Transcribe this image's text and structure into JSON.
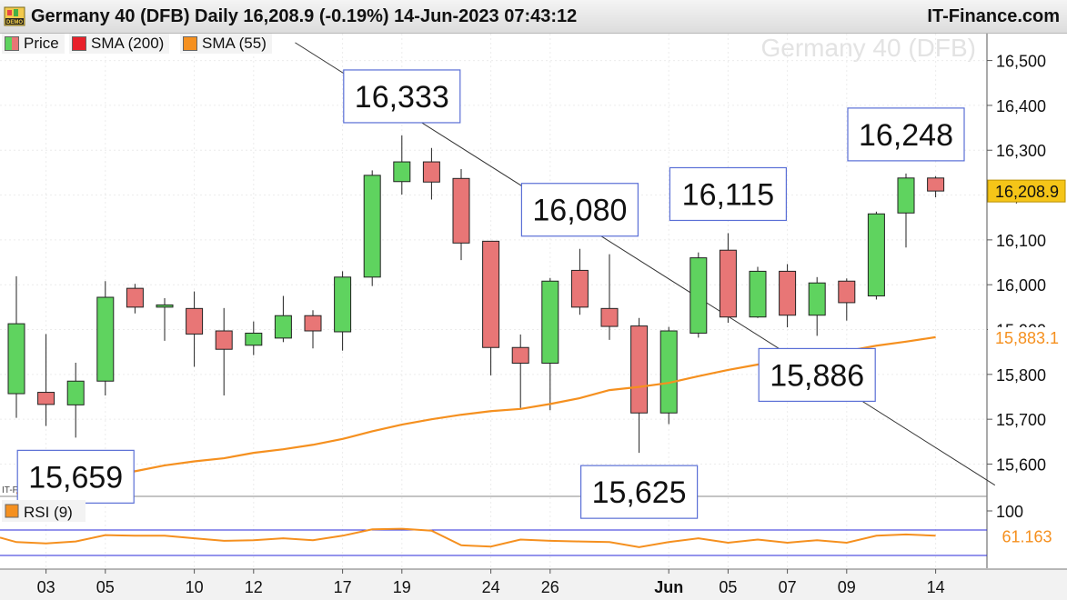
{
  "header": {
    "title": "Germany 40 (DFB) Daily 16,208.9 (-0.19%) 14-Jun-2023 07:43:12",
    "brand": "IT-Finance.com",
    "badge": "DEMO"
  },
  "legend": [
    {
      "label": "Price",
      "color": "#4caf50"
    },
    {
      "label": "SMA (200)",
      "color": "#e8202a"
    },
    {
      "label": "SMA (55)",
      "color": "#f5901f"
    }
  ],
  "watermark": "Germany 40 (DFB)",
  "small_watermark": "IT-Finance.com",
  "colors": {
    "up": "#5fd35f",
    "down": "#e87676",
    "sma55": "#f5901f",
    "trend": "#333333",
    "rsi": "#f5901f",
    "rsi_band": "#2a2ad8"
  },
  "chart_data": {
    "type": "candlestick",
    "title": "Germany 40 (DFB) Daily",
    "yticks": [
      15600,
      15700,
      15800,
      15900,
      16000,
      16100,
      16200,
      16300,
      16400,
      16500
    ],
    "ytick_labels": [
      "15,600",
      "15,700",
      "15,800",
      "15,900",
      "16,000",
      "16,100",
      "16,200",
      "16,300",
      "16,400",
      "16,500"
    ],
    "ylim": [
      15530,
      16560
    ],
    "candles": [
      {
        "o": 15757,
        "h": 16019,
        "l": 15703,
        "c": 15913
      },
      {
        "o": 15760,
        "h": 15890,
        "l": 15685,
        "c": 15733
      },
      {
        "o": 15732,
        "h": 15826,
        "l": 15659,
        "c": 15785
      },
      {
        "o": 15785,
        "h": 16008,
        "l": 15753,
        "c": 15972
      },
      {
        "o": 15992,
        "h": 16002,
        "l": 15936,
        "c": 15950
      },
      {
        "o": 15950,
        "h": 15970,
        "l": 15875,
        "c": 15955
      },
      {
        "o": 15947,
        "h": 15985,
        "l": 15817,
        "c": 15890
      },
      {
        "o": 15897,
        "h": 15948,
        "l": 15753,
        "c": 15856
      },
      {
        "o": 15865,
        "h": 15918,
        "l": 15843,
        "c": 15892
      },
      {
        "o": 15881,
        "h": 15975,
        "l": 15872,
        "c": 15931
      },
      {
        "o": 15931,
        "h": 15943,
        "l": 15858,
        "c": 15897
      },
      {
        "o": 15895,
        "h": 16030,
        "l": 15853,
        "c": 16017
      },
      {
        "o": 16017,
        "h": 16255,
        "l": 15997,
        "c": 16244
      },
      {
        "o": 16230,
        "h": 16333,
        "l": 16201,
        "c": 16274
      },
      {
        "o": 16274,
        "h": 16305,
        "l": 16190,
        "c": 16229
      },
      {
        "o": 16237,
        "h": 16258,
        "l": 16055,
        "c": 16093
      },
      {
        "o": 16097,
        "h": 16097,
        "l": 15798,
        "c": 15860
      },
      {
        "o": 15860,
        "h": 15889,
        "l": 15725,
        "c": 15825
      },
      {
        "o": 15825,
        "h": 16015,
        "l": 15720,
        "c": 16008
      },
      {
        "o": 16032,
        "h": 16080,
        "l": 15933,
        "c": 15950
      },
      {
        "o": 15947,
        "h": 16068,
        "l": 15877,
        "c": 15907
      },
      {
        "o": 15908,
        "h": 15926,
        "l": 15625,
        "c": 15714
      },
      {
        "o": 15714,
        "h": 15906,
        "l": 15689,
        "c": 15897
      },
      {
        "o": 15892,
        "h": 16072,
        "l": 15882,
        "c": 16060
      },
      {
        "o": 16077,
        "h": 16115,
        "l": 15915,
        "c": 15928
      },
      {
        "o": 15928,
        "h": 16040,
        "l": 15926,
        "c": 16030
      },
      {
        "o": 16030,
        "h": 16046,
        "l": 15905,
        "c": 15932
      },
      {
        "o": 15932,
        "h": 16017,
        "l": 15886,
        "c": 16004
      },
      {
        "o": 16008,
        "h": 16014,
        "l": 15920,
        "c": 15960
      },
      {
        "o": 15975,
        "h": 16163,
        "l": 15967,
        "c": 16158
      },
      {
        "o": 16160,
        "h": 16248,
        "l": 16083,
        "c": 16238
      },
      {
        "o": 16238,
        "h": 16242,
        "l": 16195,
        "c": 16209
      }
    ],
    "sma55": [
      15535,
      15549,
      15557,
      15571,
      15584,
      15597,
      15606,
      15613,
      15625,
      15633,
      15643,
      15656,
      15673,
      15688,
      15700,
      15710,
      15718,
      15723,
      15734,
      15747,
      15765,
      15772,
      15781,
      15796,
      15810,
      15822,
      15834,
      15842,
      15852,
      15864,
      15873,
      15883
    ],
    "sma55_last_label": "15,883.1",
    "last_price_label": "16,208.9",
    "trendline": {
      "start": {
        "index": 9.4,
        "value": 16540
      },
      "end": {
        "index": 33,
        "value": 15553
      }
    },
    "x_labels": [
      {
        "index": 1,
        "label": "03"
      },
      {
        "index": 3,
        "label": "05"
      },
      {
        "index": 6,
        "label": "10"
      },
      {
        "index": 8,
        "label": "12"
      },
      {
        "index": 11,
        "label": "17"
      },
      {
        "index": 13,
        "label": "19"
      },
      {
        "index": 16,
        "label": "24"
      },
      {
        "index": 18,
        "label": "26"
      },
      {
        "index": 22,
        "label": "Jun"
      },
      {
        "index": 24,
        "label": "05"
      },
      {
        "index": 26,
        "label": "07"
      },
      {
        "index": 28,
        "label": "09"
      },
      {
        "index": 31,
        "label": "14"
      }
    ],
    "annotations": [
      {
        "label": "16,333",
        "candle": 13,
        "side": "above"
      },
      {
        "label": "16,080",
        "candle": 19,
        "side": "above"
      },
      {
        "label": "16,115",
        "candle": 24,
        "side": "above"
      },
      {
        "label": "16,248",
        "candle": 30,
        "side": "above"
      },
      {
        "label": "15,659",
        "candle": 2,
        "side": "below"
      },
      {
        "label": "15,625",
        "candle": 21,
        "side": "below"
      },
      {
        "label": "15,886",
        "candle": 27,
        "side": "below"
      }
    ],
    "rsi": {
      "label": "RSI (9)",
      "period": 9,
      "ylim": [
        0,
        100
      ],
      "upper": 70,
      "lower": 30,
      "tick": 100,
      "tick_label": "100",
      "last_label": "61.163",
      "values": [
        58,
        51,
        49,
        52,
        62,
        61,
        61,
        57,
        53,
        54,
        57,
        54,
        61,
        71,
        72,
        69,
        46,
        44,
        55,
        53,
        52,
        51,
        43,
        51,
        57,
        50,
        55,
        50,
        54,
        50,
        61,
        63,
        61
      ]
    }
  }
}
